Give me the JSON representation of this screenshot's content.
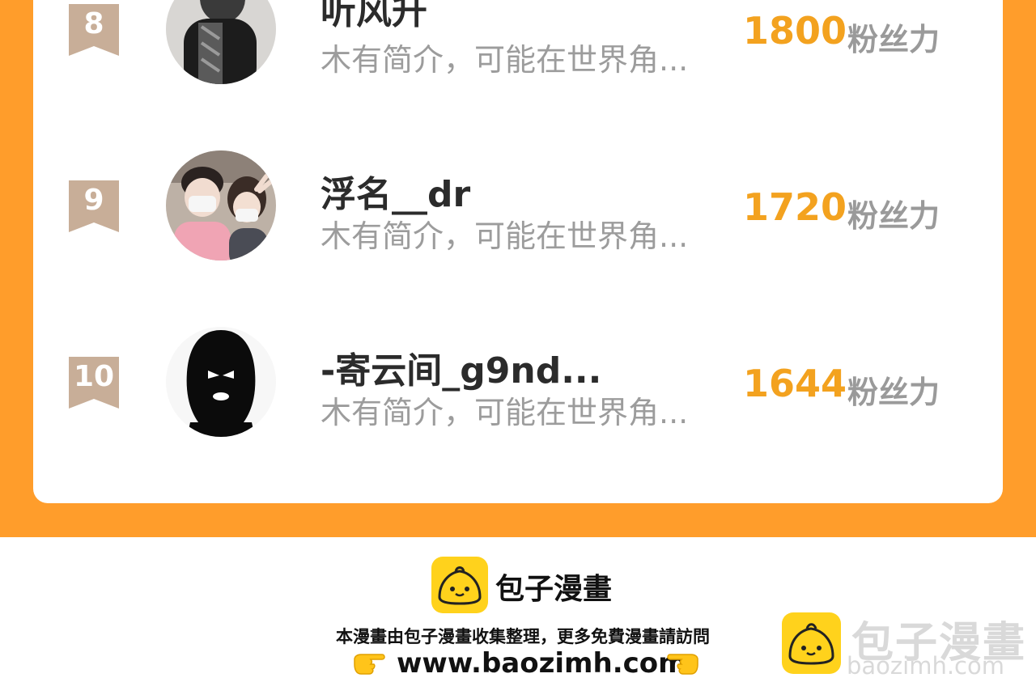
{
  "ranking": {
    "fans_unit": "粉丝力",
    "entries": [
      {
        "rank": "8",
        "name": "听风升",
        "bio": "木有简介，可能在世界角...",
        "fans": "1800"
      },
      {
        "rank": "9",
        "name": "浮名__dr",
        "bio": "木有简介，可能在世界角...",
        "fans": "1720"
      },
      {
        "rank": "10",
        "name": "-寄云间_g9nd...",
        "bio": "木有简介，可能在世界角...",
        "fans": "1644"
      }
    ]
  },
  "footer": {
    "brand": "包子漫畫",
    "notice": "本漫畫由包子漫畫收集整理，更多免費漫畫請訪問",
    "url": "www.baozimh.com"
  },
  "watermark": {
    "brand": "包子漫畫",
    "url": "baozimh.com"
  },
  "colors": {
    "frame": "#ff9d2b",
    "fans_value": "#f3a21f",
    "rank_badge": "#c8ae98",
    "logo_yellow": "#ffd21c"
  },
  "icons": [
    "rank-badge-icon",
    "bun-logo-icon",
    "pointing-right-hand-icon",
    "pointing-left-hand-icon"
  ]
}
